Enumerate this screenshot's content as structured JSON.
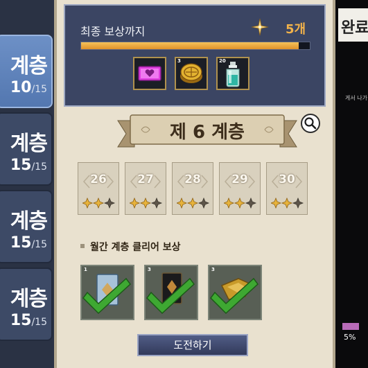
{
  "left_list": {
    "items": [
      {
        "label": "계층",
        "cleared": "10",
        "total": "/15",
        "active": true
      },
      {
        "label": "계층",
        "cleared": "15",
        "total": "/15",
        "active": false
      },
      {
        "label": "계층",
        "cleared": "15",
        "total": "/15",
        "active": false
      },
      {
        "label": "계층",
        "cleared": "15",
        "total": "/15",
        "active": false
      }
    ]
  },
  "final_reward": {
    "title": "최종 보상까지",
    "remaining": "5개",
    "progress": 0.95,
    "items": [
      {
        "icon": "pink-gem-icon",
        "qty": ""
      },
      {
        "icon": "gold-coin-icon",
        "qty": "3"
      },
      {
        "icon": "potion-bottle-icon",
        "qty": "20"
      }
    ]
  },
  "floor": {
    "title": "제 6 계층"
  },
  "stages": [
    {
      "num": "26",
      "stars": 2
    },
    {
      "num": "27",
      "stars": 2
    },
    {
      "num": "28",
      "stars": 2
    },
    {
      "num": "29",
      "stars": 2
    },
    {
      "num": "30",
      "stars": 2
    }
  ],
  "monthly_rewards": {
    "title": "월간 계층 클리어 보상",
    "items": [
      {
        "icon": "blue-card-icon",
        "qty": "1"
      },
      {
        "icon": "dark-card-icon",
        "qty": "3"
      },
      {
        "icon": "gold-ore-icon",
        "qty": "3"
      }
    ]
  },
  "challenge_button": {
    "label": "도전하기"
  },
  "background_right": {
    "title_fragment": "완료",
    "notice_fragment": "게서 나가",
    "percent": "5%"
  },
  "colors": {
    "accent_gold": "#f2b24a",
    "check_green": "#3ea832",
    "panel_bg": "#e9e1cf"
  }
}
